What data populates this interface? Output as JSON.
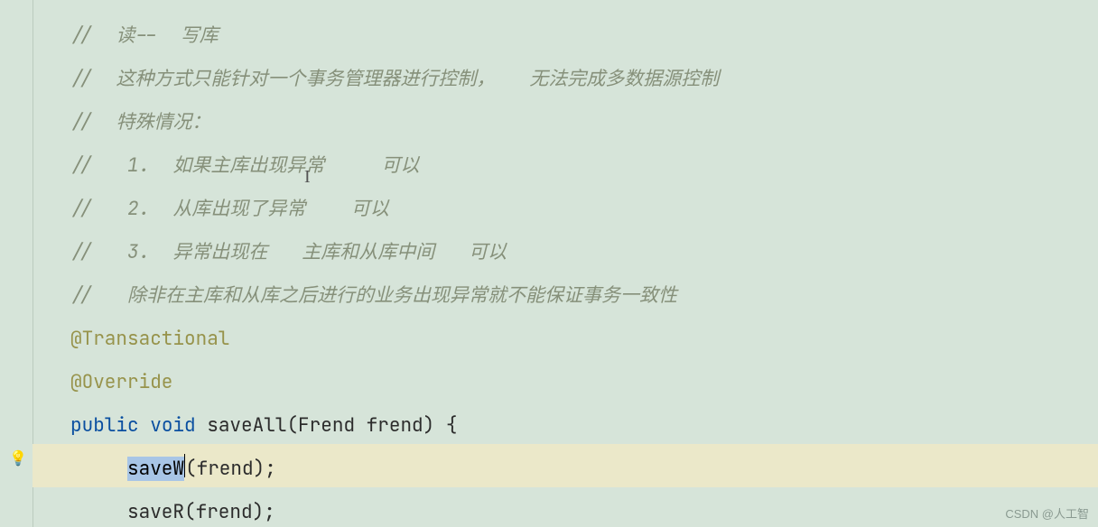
{
  "code": {
    "comments": {
      "l1": "//  读--  写库",
      "l2": "//  这种方式只能针对一个事务管理器进行控制，   无法完成多数据源控制",
      "l3": "//  特殊情况：",
      "l4": "//   1.  如果主库出现异常     可以",
      "l5": "//   2.  从库出现了异常    可以",
      "l6": "//   3.  异常出现在   主库和从库中间   可以",
      "l7": "//   除非在主库和从库之后进行的业务出现异常就不能保证事务一致性"
    },
    "annot": {
      "transactional": "@Transactional",
      "override": "@Override"
    },
    "kw": {
      "pub": "public",
      "void": "void"
    },
    "method": "saveAll",
    "param_type": "Frend",
    "param_name": "frend",
    "call1_sel": "saveW",
    "call1_arg": "(frend);",
    "call2": "saveR(frend);",
    "brace_open": "{"
  },
  "gutter": {
    "bulb": "💡"
  },
  "caret_glyph": "I",
  "watermark": "CSDN @人工智"
}
